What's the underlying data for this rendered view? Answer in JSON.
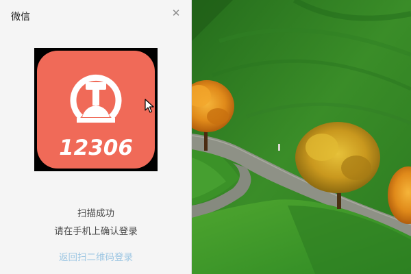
{
  "window": {
    "title": "微信",
    "close_icon": "close-icon",
    "close_glyph": "✕"
  },
  "avatar": {
    "app_logo_text": "12306",
    "tile_color": "#f06a58",
    "icon": "railway-logo-icon"
  },
  "status": {
    "line1": "扫描成功",
    "line2": "请在手机上确认登录"
  },
  "back_link": {
    "label": "返回扫二维码登录",
    "color": "#9ec7e3"
  },
  "background": {
    "icon": "landscape-background-image"
  }
}
